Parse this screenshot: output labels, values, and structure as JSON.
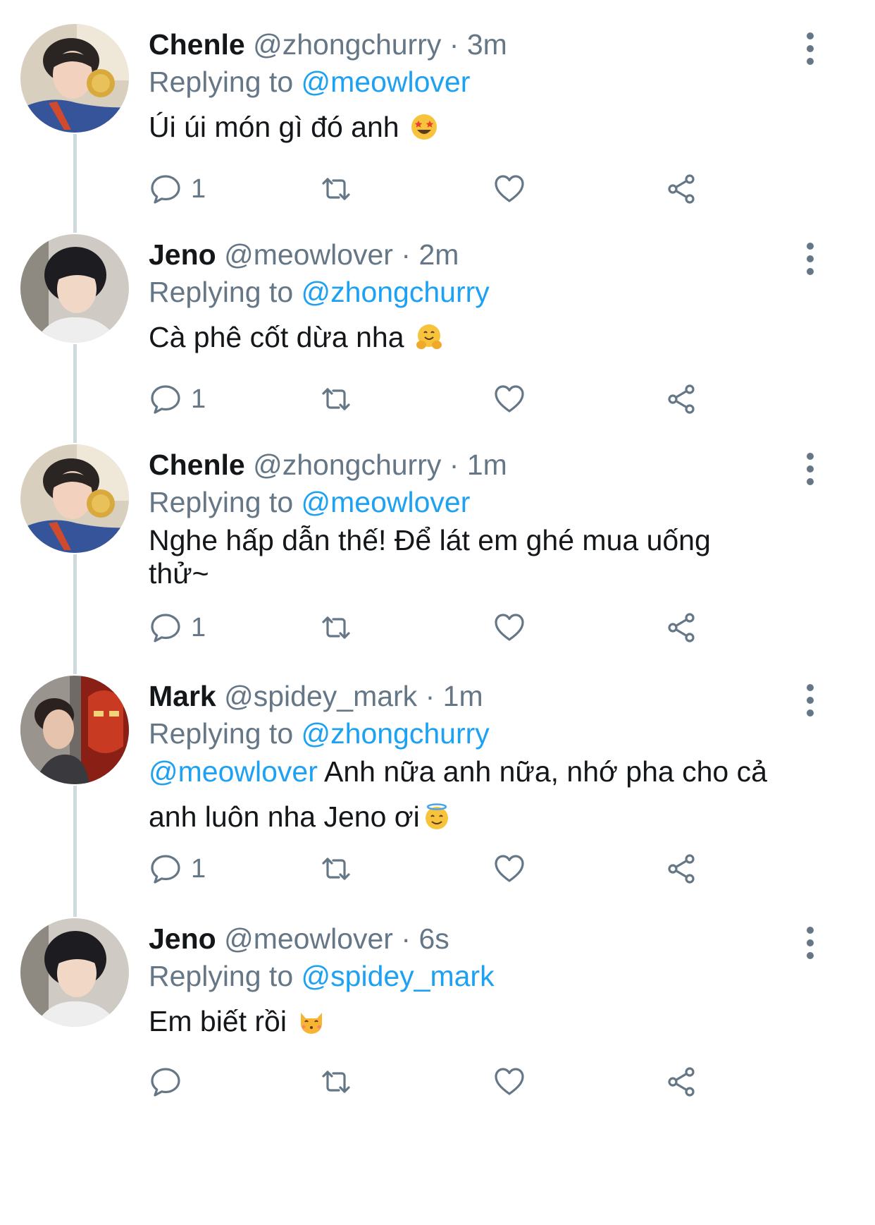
{
  "tweets": [
    {
      "name": "Chenle",
      "handle": "@zhongchurry",
      "dot": "·",
      "time": "3m",
      "replying_prefix": "Replying to",
      "replying_to": "@meowlover",
      "text_line1": "Úi úi món gì đó anh",
      "text_line2": "",
      "emoji": "star-struck-emoji",
      "reply_count": "1",
      "avatar": "chenle-avatar"
    },
    {
      "name": "Jeno",
      "handle": "@meowlover",
      "dot": "·",
      "time": "2m",
      "replying_prefix": "Replying to",
      "replying_to": "@zhongchurry",
      "text_line1": "Cà phê cốt dừa nha",
      "text_line2": "",
      "emoji": "hugging-face-emoji",
      "reply_count": "1",
      "avatar": "jeno-avatar"
    },
    {
      "name": "Chenle",
      "handle": "@zhongchurry",
      "dot": "·",
      "time": "1m",
      "replying_prefix": "Replying to",
      "replying_to": "@meowlover",
      "text_line1": "Nghe hấp dẫn thế! Để lát em ghé mua uống",
      "text_line2": "thử~",
      "emoji": "",
      "reply_count": "1",
      "avatar": "chenle-avatar"
    },
    {
      "name": "Mark",
      "handle": "@spidey_mark",
      "dot": "·",
      "time": "1m",
      "replying_prefix": "Replying to",
      "replying_to": "@zhongchurry",
      "text_mention": "@meowlover",
      "text_line1": " Anh nữa anh nữa, nhớ pha cho cả",
      "text_line2": "anh luôn nha Jeno ơi",
      "emoji": "smiling-face-with-halo-emoji",
      "reply_count": "1",
      "avatar": "mark-avatar"
    },
    {
      "name": "Jeno",
      "handle": "@meowlover",
      "dot": "·",
      "time": "6s",
      "replying_prefix": "Replying to",
      "replying_to": "@spidey_mark",
      "text_line1": "Em biết rồi",
      "text_line2": "",
      "emoji": "kissing-cat-emoji",
      "reply_count": "",
      "avatar": "jeno-avatar"
    }
  ],
  "colors": {
    "text": "#14171a",
    "secondary": "#657786",
    "link": "#1da1f2",
    "rail": "#cfd9de"
  }
}
